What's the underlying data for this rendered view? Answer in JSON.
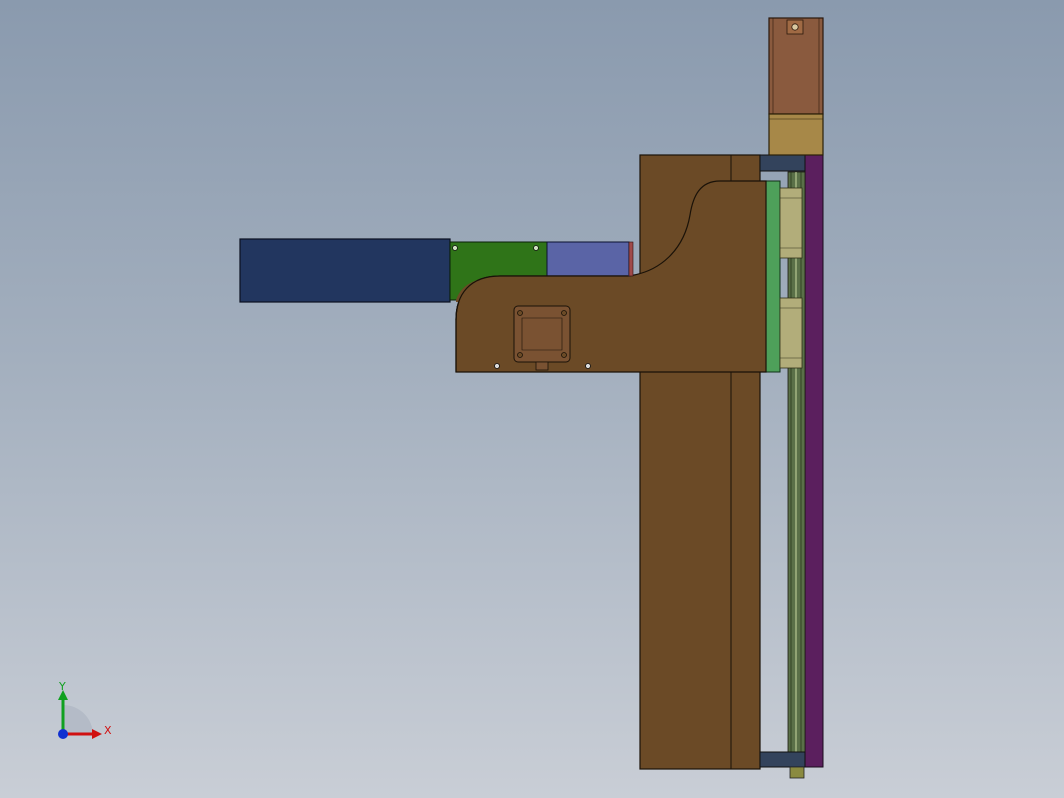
{
  "triad": {
    "x_label": "X",
    "y_label": "Y"
  },
  "colors": {
    "background_top": "#8a9aae",
    "background_bottom": "#c9ced6",
    "column_brown": "#6b4a26",
    "arm_blue": "#22365f",
    "arm_green": "#2f7418",
    "arm_light_blue": "#5a64a6",
    "carriage_green": "#4ea05a",
    "rail_purple": "#5b1f5e",
    "motor_tan": "#a78848",
    "motor_brown": "#8a5a3e",
    "axis_x": "#d01010",
    "axis_y": "#10a020",
    "axis_z": "#1030d0"
  }
}
